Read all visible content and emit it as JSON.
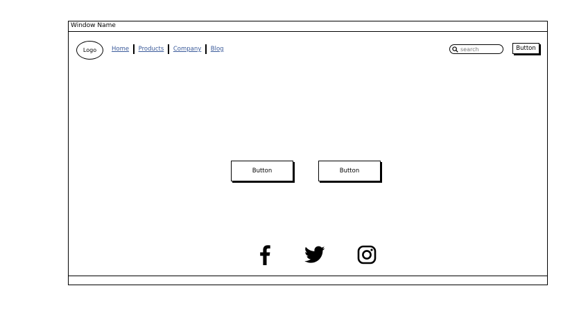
{
  "window": {
    "title": "Window Name"
  },
  "header": {
    "logo_text": "Logo",
    "nav": [
      {
        "label": "Home"
      },
      {
        "label": "Products"
      },
      {
        "label": "Company"
      },
      {
        "label": "Blog"
      }
    ],
    "search": {
      "placeholder": "search",
      "icon": "search-icon"
    },
    "button_label": "Button"
  },
  "main": {
    "buttons": [
      {
        "label": "Button"
      },
      {
        "label": "Button"
      }
    ]
  },
  "footer": {
    "social_icons": [
      "facebook-icon",
      "twitter-icon",
      "instagram-icon"
    ]
  },
  "colors": {
    "ink": "#000000",
    "link": "#3a5a9a",
    "background": "#ffffff"
  }
}
